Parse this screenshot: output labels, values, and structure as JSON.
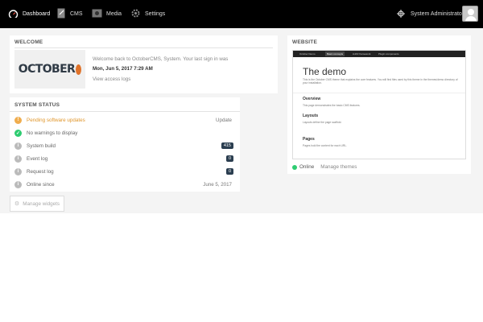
{
  "nav": {
    "dashboard": "Dashboard",
    "cms": "CMS",
    "media": "Media",
    "settings": "Settings",
    "user": "System Administrator"
  },
  "welcome": {
    "title": "WELCOME",
    "logo_text": "OCTOBER",
    "message": "Welcome back to OctoberCMS, System. Your last sign in was",
    "date": "Mon, Jun 5, 2017 7:29 AM",
    "link": "View access logs"
  },
  "status": {
    "title": "SYSTEM STATUS",
    "rows": [
      {
        "label": "Pending software updates",
        "value": "Update",
        "icon_color": "#f0ad4e"
      },
      {
        "label": "No warnings to display",
        "value": "",
        "icon_color": "#2ecc71"
      },
      {
        "label": "System build",
        "value": "415",
        "icon_color": "#bbbbbb"
      },
      {
        "label": "Event log",
        "value": "0",
        "icon_color": "#bbbbbb"
      },
      {
        "label": "Request log",
        "value": "0",
        "icon_color": "#bbbbbb"
      },
      {
        "label": "Online since",
        "value": "June 5, 2017",
        "icon_color": "#bbbbbb"
      }
    ]
  },
  "website": {
    "title": "WEBSITE",
    "preview": {
      "tabs": [
        "October Demo",
        "Basic concepts",
        "AJAX framework",
        "Plugin components"
      ],
      "heading": "The demo",
      "intro": "This is the October CMS theme that explains the core features. You will find files used by this theme in the themes/demo directory of your installation.",
      "overview": "Overview",
      "overview_text": "This page demonstrates the basic CMS features.",
      "layouts": "Layouts",
      "layouts_text": "Layouts define the page scaffold.",
      "pages": "Pages",
      "pages_text": "Pages hold the content for each URL."
    },
    "online": "Online",
    "manage": "Manage themes"
  },
  "manage_widgets": "Manage widgets",
  "colors": {
    "topbar": "#000000",
    "online": "#2ecc71",
    "pending": "#f0ad4e",
    "badge": "#2b3e50"
  }
}
